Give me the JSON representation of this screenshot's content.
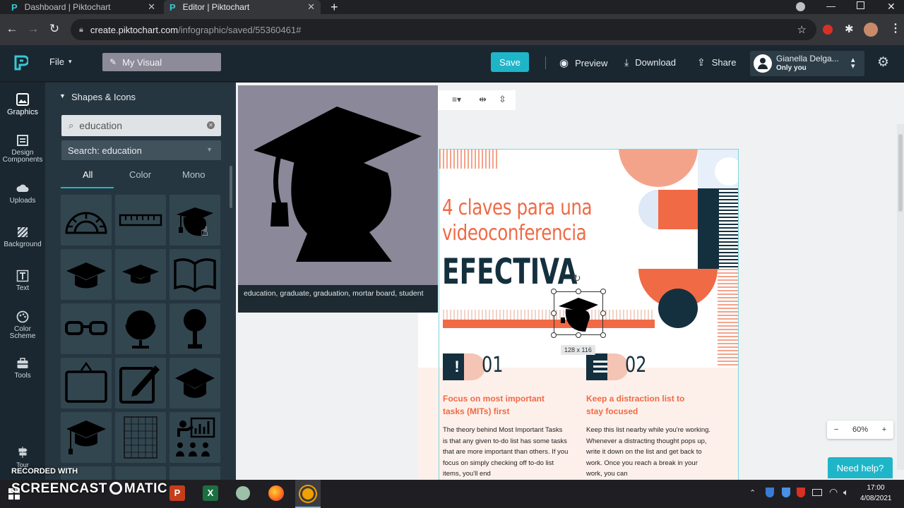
{
  "browser": {
    "tabs": [
      {
        "label": "Dashboard | Piktochart",
        "active": false
      },
      {
        "label": "Editor | Piktochart",
        "active": true
      }
    ],
    "url_host": "create.piktochart.com",
    "url_path": "/infographic/saved/55360461#"
  },
  "header": {
    "file_label": "File",
    "my_visual_label": "My Visual",
    "save_label": "Save",
    "preview_label": "Preview",
    "download_label": "Download",
    "share_label": "Share",
    "user_name": "Gianella Delga...",
    "user_sub": "Only you"
  },
  "rail": {
    "items": [
      {
        "label": "Graphics",
        "icon": "image-icon"
      },
      {
        "label": "Design Components",
        "icon": "components-icon"
      },
      {
        "label": "Uploads",
        "icon": "cloud-upload-icon"
      },
      {
        "label": "Background",
        "icon": "background-icon"
      },
      {
        "label": "Text",
        "icon": "text-icon"
      },
      {
        "label": "Color Scheme",
        "icon": "palette-icon"
      },
      {
        "label": "Tools",
        "icon": "toolbox-icon"
      },
      {
        "label": "Tour",
        "icon": "tour-icon"
      }
    ]
  },
  "panel": {
    "section_title": "Shapes & Icons",
    "search_value": "education",
    "search_dropdown": "Search: education",
    "filter_tabs": [
      "All",
      "Color",
      "Mono"
    ],
    "active_filter": "All"
  },
  "preview": {
    "caption": "education, graduate, graduation, mortar board, student"
  },
  "artboard": {
    "title_line1": "4 claves para una",
    "title_line2": "videoconferencia",
    "title_big": "EFECTIVA",
    "size_label": "128 x 116",
    "num1": "01",
    "num2": "02",
    "head1": "Focus on most important tasks (MITs) first",
    "head2": "Keep a distraction list to stay focused",
    "body1": "The theory behind Most Important Tasks is that any given to-do list has some tasks that are more important than others. If you focus on simply checking off to-do list items, you'll end",
    "body2": "Keep this list nearby while you're working. Whenever a distracting thought pops up, write it down on the list and get back to work. Once you reach a break in your work, you can",
    "colors": {
      "accent": "#f06a45",
      "salmon": "#f4a38b",
      "navy": "#14303f",
      "teal": "#1fb5c9"
    }
  },
  "zoom": {
    "value": "60%",
    "minus": "−",
    "plus": "+"
  },
  "help_label": "Need help?",
  "taskbar": {
    "recorded": "RECORDED WITH",
    "brand": "SCREENCAST",
    "brand2": "MATIC",
    "time": "17:00",
    "date": "4/08/2021"
  }
}
